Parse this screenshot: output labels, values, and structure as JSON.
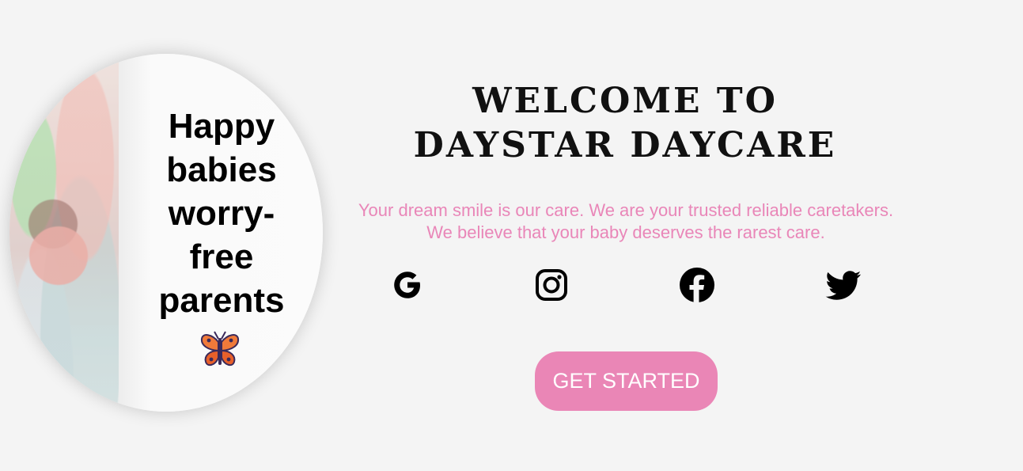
{
  "hero": {
    "tagline_lines": [
      "Happy",
      "babies",
      "worry-",
      "free",
      "parents"
    ],
    "icon": "butterfly-icon"
  },
  "main": {
    "heading_lines": [
      "WELCOME TO",
      "DAYSTAR DAYCARE"
    ],
    "subtitle_lines": [
      "Your dream smile is our care. We are your trusted reliable caretakers.",
      "We believe that your baby deserves the rarest care."
    ],
    "social_icons": [
      "google-icon",
      "instagram-icon",
      "facebook-icon",
      "twitter-icon"
    ],
    "cta_label": "GET STARTED"
  },
  "colors": {
    "accent": "#ea86b6",
    "background": "#f4f4f4",
    "text": "#000000"
  }
}
